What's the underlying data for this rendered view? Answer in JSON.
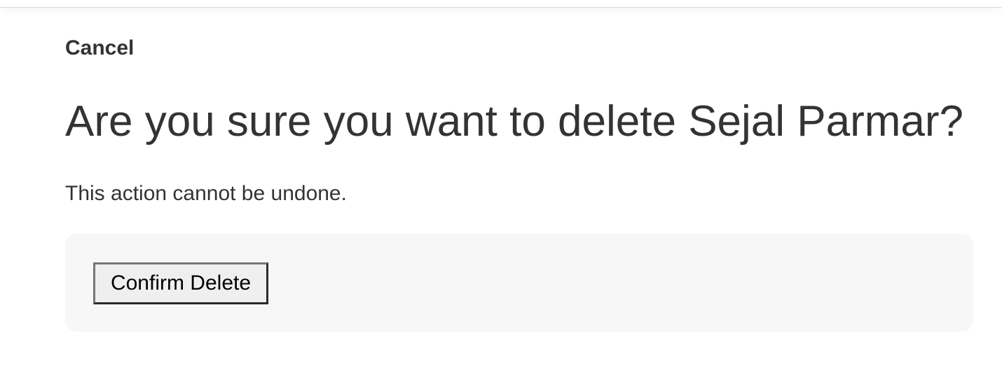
{
  "header": {
    "cancel_label": "Cancel"
  },
  "main": {
    "title": "Are you sure you want to delete Sejal Parmar?",
    "warning": "This action cannot be undone.",
    "confirm_label": "Confirm Delete"
  },
  "colors": {
    "text": "#333333",
    "panel_background": "#f7f7f7",
    "button_background": "#efefef"
  }
}
